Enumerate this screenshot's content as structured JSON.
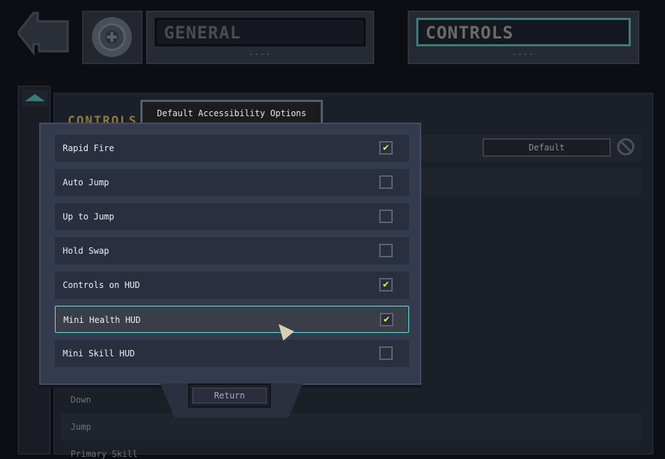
{
  "header": {
    "tabs": [
      {
        "label": "GENERAL",
        "active": false
      },
      {
        "label": "CONTROLS",
        "active": true
      }
    ],
    "back_icon": "back-arrow-icon",
    "settings_icon": "gear-icon"
  },
  "background": {
    "section_label": "CONTROLS",
    "default_label": "Default",
    "items": [
      "Down",
      "Jump",
      "Primary Skill"
    ]
  },
  "dialog": {
    "title": "Default Accessibility Options",
    "options": [
      {
        "label": "Rapid Fire",
        "checked": true
      },
      {
        "label": "Auto Jump",
        "checked": false
      },
      {
        "label": "Up to Jump",
        "checked": false
      },
      {
        "label": "Hold Swap",
        "checked": false
      },
      {
        "label": "Controls on HUD",
        "checked": true
      },
      {
        "label": "Mini Health HUD",
        "checked": true,
        "highlighted": true
      },
      {
        "label": "Mini Skill HUD",
        "checked": false
      }
    ],
    "return_label": "Return"
  },
  "colors": {
    "highlight": "#66e0dc",
    "check": "#ecec5a",
    "panel": "#353b4f"
  }
}
